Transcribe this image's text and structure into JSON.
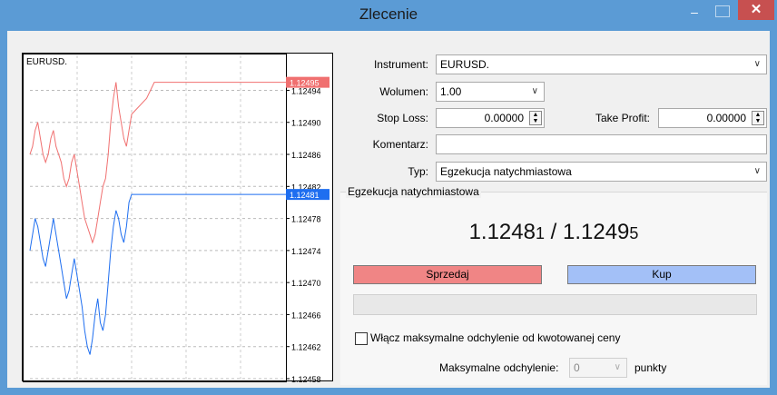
{
  "window": {
    "title": "Zlecenie",
    "minimize_symbol": "–",
    "close_symbol": "✕",
    "titlebar_color": "#5b9bd5",
    "close_color": "#c75050"
  },
  "chart": {
    "symbol": "EURUSD.",
    "price_ticks": [
      "1.12494",
      "1.12490",
      "1.12486",
      "1.12482",
      "1.12478",
      "1.12474",
      "1.12470",
      "1.12466",
      "1.12462",
      "1.12458"
    ],
    "ask_label": "1.12495",
    "bid_label": "1.12481",
    "ask_color": "#f07070",
    "bid_color": "#1e6ef0",
    "ask_series": [
      1.12486,
      1.12487,
      1.12489,
      1.1249,
      1.12488,
      1.12486,
      1.12485,
      1.12486,
      1.12488,
      1.12489,
      1.12487,
      1.12486,
      1.12485,
      1.12483,
      1.12482,
      1.12483,
      1.12485,
      1.12486,
      1.12484,
      1.12482,
      1.1248,
      1.12478,
      1.12477,
      1.12476,
      1.12475,
      1.12476,
      1.12478,
      1.1248,
      1.12482,
      1.12483,
      1.12486,
      1.1249,
      1.12493,
      1.12495,
      1.12492,
      1.1249,
      1.12488,
      1.12487,
      1.12489,
      1.12491,
      1.12493,
      1.12495,
      1.12495,
      1.12495,
      1.12495,
      1.12495,
      1.12495,
      1.12495,
      1.12495,
      1.12495,
      1.12495,
      1.12495,
      1.12495,
      1.12495,
      1.12495,
      1.12495,
      1.12495,
      1.12495,
      1.12495,
      1.12495
    ],
    "bid_series": [
      1.12474,
      1.12476,
      1.12478,
      1.12477,
      1.12475,
      1.12473,
      1.12472,
      1.12474,
      1.12476,
      1.12478,
      1.12476,
      1.12474,
      1.12472,
      1.1247,
      1.12468,
      1.12469,
      1.12471,
      1.12473,
      1.12471,
      1.12469,
      1.12467,
      1.12464,
      1.12462,
      1.12461,
      1.12463,
      1.12466,
      1.12468,
      1.12465,
      1.12464,
      1.12466,
      1.1247,
      1.12474,
      1.12477,
      1.12479,
      1.12478,
      1.12476,
      1.12475,
      1.12477,
      1.1248,
      1.12481,
      1.12481,
      1.12481,
      1.12481,
      1.12481,
      1.12481,
      1.12481,
      1.12481,
      1.12481,
      1.12481,
      1.12481,
      1.12481,
      1.12481,
      1.12481,
      1.12481,
      1.12481,
      1.12481,
      1.12481,
      1.12481,
      1.12481,
      1.12481
    ],
    "price_min": 1.12458,
    "price_max": 1.12497
  },
  "form": {
    "instrument_label": "Instrument:",
    "instrument_value": "EURUSD.",
    "volume_label": "Wolumen:",
    "volume_value": "1.00",
    "stop_loss_label": "Stop Loss:",
    "stop_loss_value": "0.00000",
    "take_profit_label": "Take Profit:",
    "take_profit_value": "0.00000",
    "comment_label": "Komentarz:",
    "comment_value": "",
    "type_label": "Typ:",
    "type_value": "Egzekucja natychmiastowa"
  },
  "execution": {
    "group_title": "Egzekucja natychmiastowa",
    "bid_main": "1.1248",
    "bid_last": "1",
    "separator": " / ",
    "ask_main": "1.1249",
    "ask_last": "5",
    "sell_label": "Sprzedaj",
    "buy_label": "Kup",
    "max_dev_checkbox_label": "Włącz maksymalne odchylenie od kwotowanej ceny",
    "max_dev_label": "Maksymalne odchylenie:",
    "max_dev_value": "0",
    "max_dev_unit": "punkty"
  }
}
